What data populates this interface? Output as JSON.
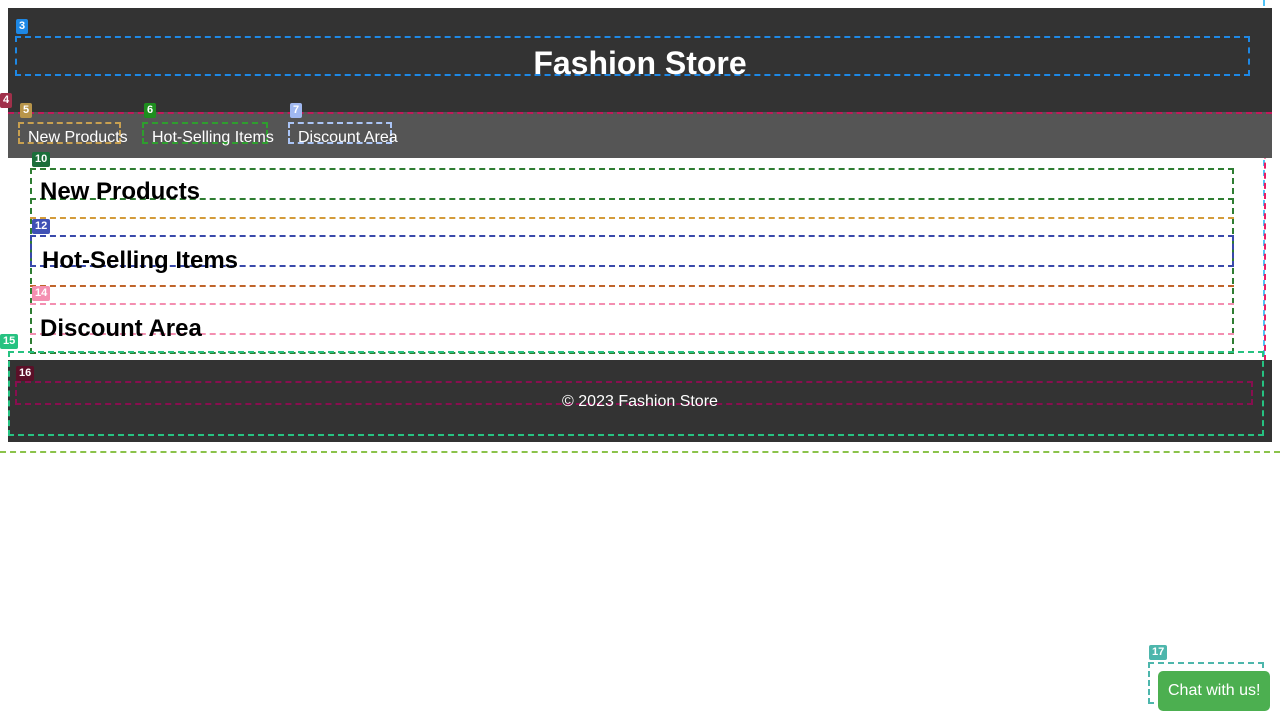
{
  "header": {
    "title": "Fashion Store"
  },
  "nav": {
    "items": [
      {
        "label": "New Products"
      },
      {
        "label": "Hot-Selling Items"
      },
      {
        "label": "Discount Area"
      }
    ]
  },
  "sections": [
    {
      "title": "New Products"
    },
    {
      "title": "Hot-Selling Items"
    },
    {
      "title": "Discount Area"
    }
  ],
  "footer": {
    "copyright": "© 2023 Fashion Store"
  },
  "chat": {
    "label": "Chat with us!"
  },
  "badges": [
    "3",
    "4",
    "5",
    "6",
    "7",
    "10",
    "12",
    "14",
    "15",
    "16",
    "17"
  ],
  "colors": {
    "header_bg": "#333333",
    "nav_bg": "#555555",
    "footer_bg": "#333333",
    "chat_bg": "#4caf50"
  }
}
